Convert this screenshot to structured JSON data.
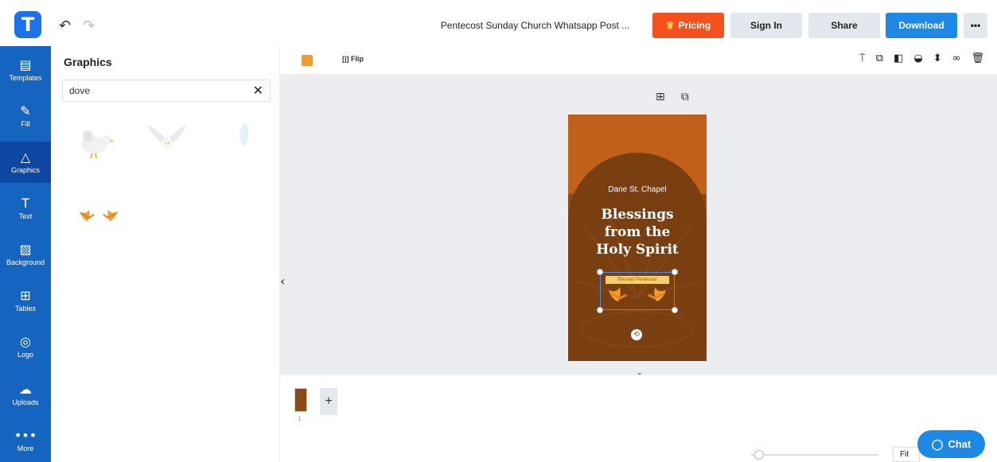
{
  "app": {
    "logo_letter": "T",
    "undo_icon": "↶",
    "redo_icon": "↷"
  },
  "header": {
    "doc_title": "Pentecost Sunday Church Whatsapp Post ...",
    "pricing_label": "Pricing",
    "signin_label": "Sign In",
    "share_label": "Share",
    "download_label": "Download",
    "more_label": "•••"
  },
  "sidebar": {
    "items": [
      {
        "label": "Templates",
        "icon": "▤"
      },
      {
        "label": "Fill",
        "icon": "✎"
      },
      {
        "label": "Graphics",
        "icon": "△"
      },
      {
        "label": "Text",
        "icon": "T"
      },
      {
        "label": "Background",
        "icon": "▨"
      },
      {
        "label": "Tables",
        "icon": "⊞"
      },
      {
        "label": "Logo",
        "icon": "◎"
      },
      {
        "label": "Uploads",
        "icon": "☁"
      },
      {
        "label": "More",
        "icon": "•••"
      }
    ]
  },
  "panel": {
    "title": "Graphics",
    "search_value": "dove",
    "clear_icon": "✕"
  },
  "toolbar": {
    "flip_label": "Flip",
    "flip_icon": "[|]",
    "tool_icons": [
      "⍑",
      "⧉",
      "◧",
      "◒",
      "⬍",
      "∞",
      "🗑"
    ]
  },
  "canvas": {
    "add_icon": "⊞",
    "copy_icon": "⧉",
    "collapse_icon": "‹",
    "expand_icon": "⌄",
    "poster": {
      "chapel": "Dane St. Chapel",
      "headline_1": "Blessings",
      "headline_2": "from the",
      "headline_3": "Holy Spirit",
      "banner": "Blessed Pentecost"
    }
  },
  "pages": {
    "page_number": "1",
    "add_icon": "+"
  },
  "zoom": {
    "fit_label": "Fit",
    "level": 0.05
  },
  "chat": {
    "label": "Chat",
    "icon": "◯"
  },
  "colors": {
    "accent": "#1565c0",
    "pricing": "#f4511e",
    "poster": "#8b4a14",
    "selected_color": "#f39c32"
  }
}
